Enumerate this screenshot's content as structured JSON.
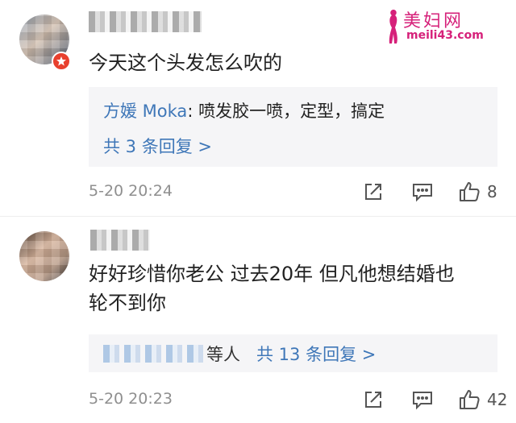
{
  "watermark": {
    "title": "美妇网",
    "url": "meili43.com"
  },
  "comments": [
    {
      "text": "今天这个头发怎么吹的",
      "verified": true,
      "reply_preview": {
        "author": "方媛 Moka",
        "separator": ": ",
        "body": "喷发胶一喷，定型，搞定",
        "more": "共 3 条回复 >"
      },
      "time": "5-20 20:24",
      "likes": "8"
    },
    {
      "text_lines": [
        "好好珍惜你老公 过去20年 但凡他想结婚也",
        "轮不到你"
      ],
      "reply_preview": {
        "others": "等人",
        "more": "共 13 条回复 >"
      },
      "time": "5-20 20:23",
      "likes": "42"
    }
  ],
  "icons": {
    "share": "share-icon",
    "comment": "comment-icon",
    "like": "thumbs-up-icon",
    "verified": "verified-badge-icon"
  },
  "colors": {
    "link": "#3f77b8",
    "reply_bg": "#f5f5f7",
    "meta": "#8f8f8f",
    "badge": "#e8402e",
    "watermark": "#d6217a"
  }
}
